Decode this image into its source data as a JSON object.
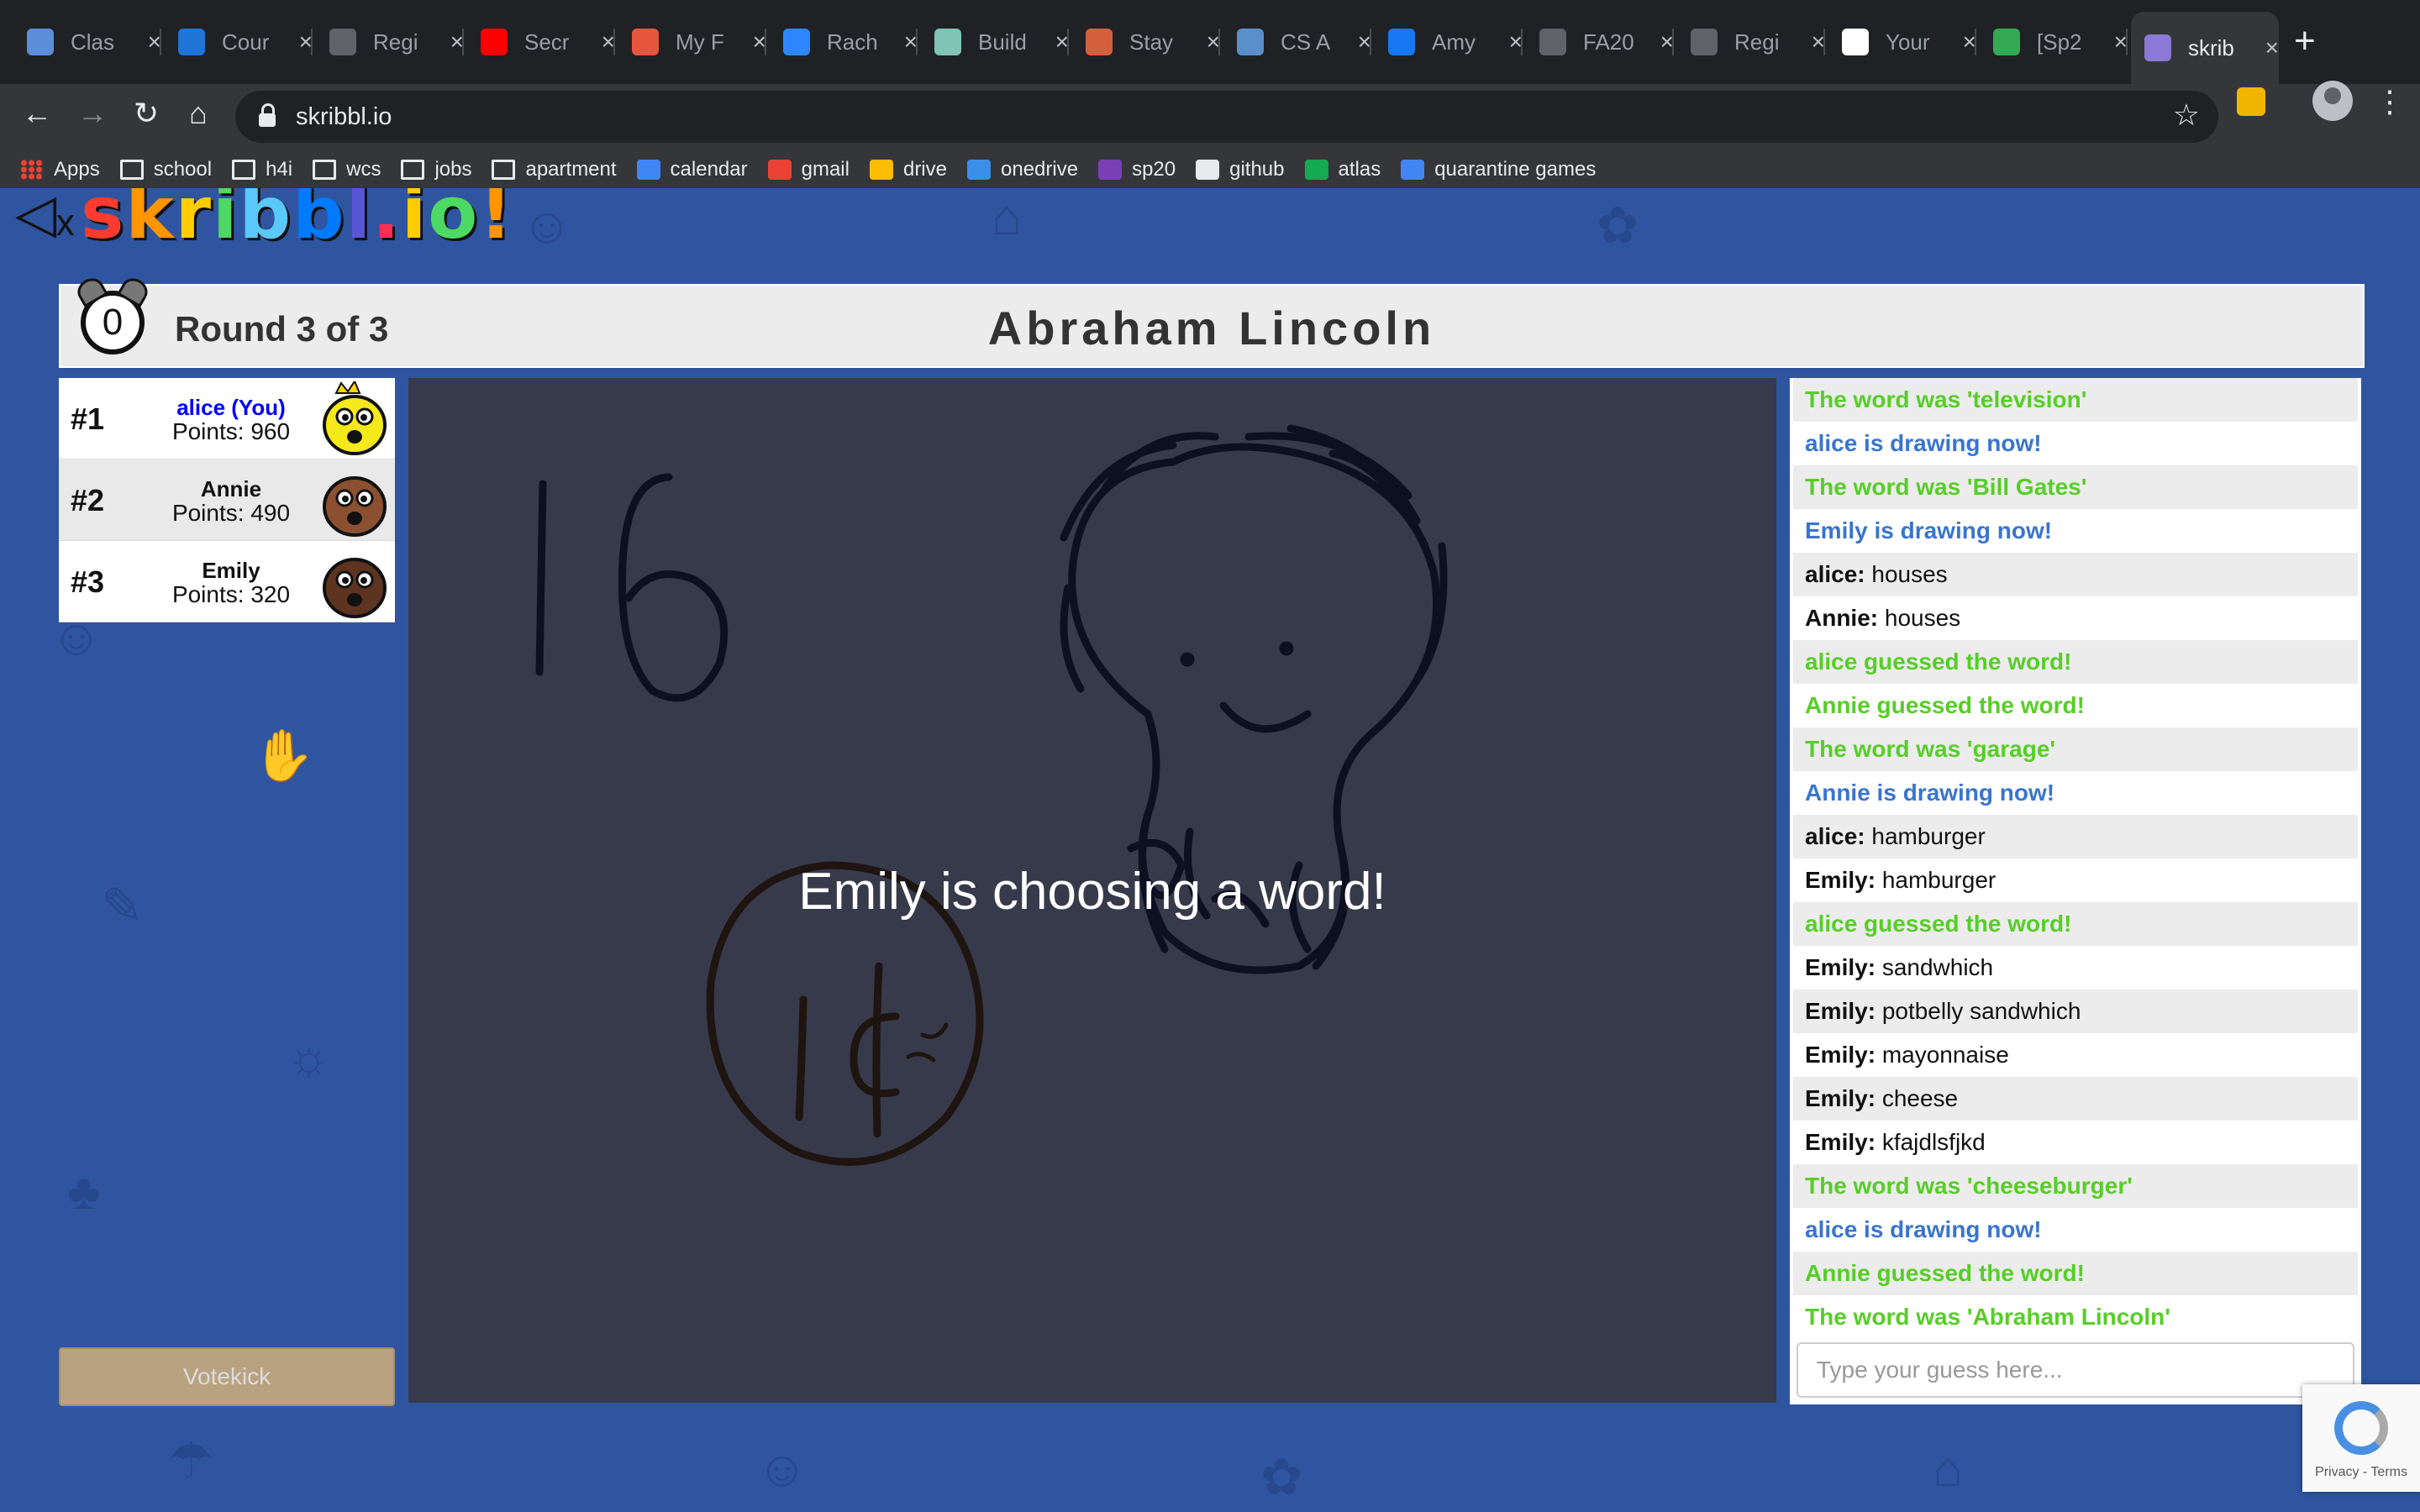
{
  "browser": {
    "tabs": [
      {
        "title": "Clas",
        "favicon": "circle-play-icon",
        "color": "#5b8dd9"
      },
      {
        "title": "Cour",
        "favicon": "c-logo-icon",
        "color": "#1f74d6"
      },
      {
        "title": "Regi",
        "favicon": "globe-icon",
        "color": "#5f6368"
      },
      {
        "title": "Secr",
        "favicon": "youtube-icon",
        "color": "#ff0000"
      },
      {
        "title": "My F",
        "favicon": "i-logo-icon",
        "color": "#e8553e"
      },
      {
        "title": "Rach",
        "favicon": "messenger-icon",
        "color": "#2d88ff"
      },
      {
        "title": "Build",
        "favicon": "f-logo-icon",
        "color": "#7fc4b5"
      },
      {
        "title": "Stay",
        "favicon": "p-circle-icon",
        "color": "#d35f3c"
      },
      {
        "title": "CS A",
        "favicon": "p-square-icon",
        "color": "#5a8fc9"
      },
      {
        "title": "Amy",
        "favicon": "facebook-icon",
        "color": "#1877f2"
      },
      {
        "title": "FA20",
        "favicon": "globe-icon",
        "color": "#5f6368"
      },
      {
        "title": "Regi",
        "favicon": "globe-icon",
        "color": "#5f6368"
      },
      {
        "title": "Your",
        "favicon": "amazon-icon",
        "color": "#ffffff"
      },
      {
        "title": "[Sp2",
        "favicon": "drive-icon",
        "color": "#34a853"
      },
      {
        "title": "skrib",
        "favicon": "skribbl-icon",
        "color": "#8a7ad6",
        "active": true
      }
    ],
    "url": "skribbl.io",
    "bookmarks": [
      {
        "label": "Apps",
        "icon": "apps-grid-icon"
      },
      {
        "label": "school",
        "icon": "folder-icon"
      },
      {
        "label": "h4i",
        "icon": "folder-icon"
      },
      {
        "label": "wcs",
        "icon": "folder-icon"
      },
      {
        "label": "jobs",
        "icon": "folder-icon"
      },
      {
        "label": "apartment",
        "icon": "folder-icon"
      },
      {
        "label": "calendar",
        "icon": "calendar-icon"
      },
      {
        "label": "gmail",
        "icon": "gmail-icon"
      },
      {
        "label": "drive",
        "icon": "drive-icon"
      },
      {
        "label": "onedrive",
        "icon": "cloud-icon"
      },
      {
        "label": "sp20",
        "icon": "onenote-icon"
      },
      {
        "label": "github",
        "icon": "github-icon"
      },
      {
        "label": "atlas",
        "icon": "leaf-icon"
      },
      {
        "label": "quarantine games",
        "icon": "doc-icon"
      }
    ]
  },
  "game": {
    "logo": "skribbl.io!",
    "timer": "0",
    "round": "Round 3 of 3",
    "word": "Abraham Lincoln",
    "overlay": "Emily is choosing a word!",
    "votekick": "Votekick",
    "guess_placeholder": "Type your guess here...",
    "recaptcha": "Privacy - Terms",
    "players": [
      {
        "rank": "#1",
        "name": "alice (You)",
        "points": "Points: 960",
        "you": true,
        "avatar_color": "#f5e81b"
      },
      {
        "rank": "#2",
        "name": "Annie",
        "points": "Points: 490",
        "you": false,
        "avatar_color": "#8a5030"
      },
      {
        "rank": "#3",
        "name": "Emily",
        "points": "Points: 320",
        "you": false,
        "avatar_color": "#5c3420"
      }
    ],
    "chat": [
      {
        "type": "green",
        "text": "The word was 'television'"
      },
      {
        "type": "blue",
        "text": "alice is drawing now!"
      },
      {
        "type": "green",
        "text": "The word was 'Bill Gates'"
      },
      {
        "type": "blue",
        "text": "Emily is drawing now!"
      },
      {
        "type": "msg",
        "who": "alice:",
        "text": "houses"
      },
      {
        "type": "msg",
        "who": "Annie:",
        "text": "houses"
      },
      {
        "type": "green",
        "text": "alice guessed the word!"
      },
      {
        "type": "green",
        "text": "Annie guessed the word!"
      },
      {
        "type": "green",
        "text": "The word was 'garage'"
      },
      {
        "type": "blue",
        "text": "Annie is drawing now!"
      },
      {
        "type": "msg",
        "who": "alice:",
        "text": "hamburger"
      },
      {
        "type": "msg",
        "who": "Emily:",
        "text": "hamburger"
      },
      {
        "type": "green",
        "text": "alice guessed the word!"
      },
      {
        "type": "msg",
        "who": "Emily:",
        "text": "sandwhich"
      },
      {
        "type": "msg",
        "who": "Emily:",
        "text": "potbelly sandwhich"
      },
      {
        "type": "msg",
        "who": "Emily:",
        "text": "mayonnaise"
      },
      {
        "type": "msg",
        "who": "Emily:",
        "text": "cheese"
      },
      {
        "type": "msg",
        "who": "Emily:",
        "text": "kfajdlsfjkd"
      },
      {
        "type": "green",
        "text": "The word was 'cheeseburger'"
      },
      {
        "type": "blue",
        "text": "alice is drawing now!"
      },
      {
        "type": "green",
        "text": "Annie guessed the word!"
      },
      {
        "type": "green",
        "text": "The word was 'Abraham Lincoln'"
      }
    ]
  }
}
